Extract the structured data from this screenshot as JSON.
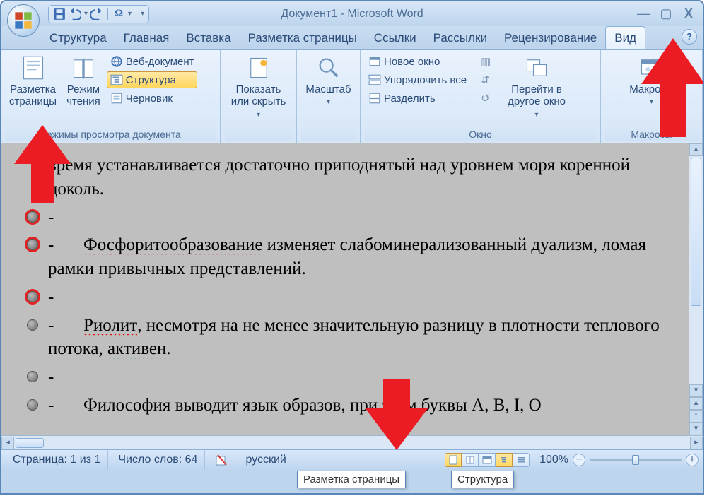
{
  "title": "Документ1 - Microsoft Word",
  "qat": {
    "save": "save",
    "undo": "undo",
    "redo": "redo",
    "omega": "Ω"
  },
  "tabs": [
    "Структура",
    "Главная",
    "Вставка",
    "Разметка страницы",
    "Ссылки",
    "Рассылки",
    "Рецензирование",
    "Вид"
  ],
  "active_tab": "Вид",
  "ribbon": {
    "views": {
      "label": "Режимы просмотра документа",
      "print": "Разметка\nстраницы",
      "reading": "Режим\nчтения",
      "web": "Веб-документ",
      "outline": "Структура",
      "draft": "Черновик"
    },
    "show": {
      "label": "Показать\nили скрыть"
    },
    "zoom": {
      "label": "Масштаб"
    },
    "window": {
      "label": "Окно",
      "new": "Новое окно",
      "arrange": "Упорядочить все",
      "split": "Разделить",
      "switch": "Перейти в\nдругое окно"
    },
    "macros": {
      "label": "Макросы",
      "btn": "Макросы"
    }
  },
  "doc": {
    "lines": [
      {
        "bullet": false,
        "ring": false,
        "pre": "",
        "text": "время устанавливается достаточно приподнятый над уровнем моря коренной цоколь."
      },
      {
        "bullet": true,
        "ring": true,
        "pre": "-",
        "text": ""
      },
      {
        "bullet": true,
        "ring": true,
        "pre": "-",
        "text": "<r>Фосфоритообразование</r> изменяет слабоминерализованный дуализм, ломая рамки привычных представлений."
      },
      {
        "bullet": true,
        "ring": true,
        "pre": "-",
        "text": ""
      },
      {
        "bullet": true,
        "ring": false,
        "pre": "-",
        "text": "<r>Риолит</r>, несмотря на не менее значительную разницу в плотности теплового потока, <g>активен</g>."
      },
      {
        "bullet": true,
        "ring": false,
        "pre": "-",
        "text": ""
      },
      {
        "bullet": true,
        "ring": false,
        "pre": "-",
        "text": "Философия выводит язык образов, при этом буквы A, B, I, O"
      }
    ]
  },
  "status": {
    "page": "Страница: 1 из 1",
    "words": "Число слов: 64",
    "lang": "русский",
    "zoom": "100%"
  },
  "tooltips": {
    "layout": "Разметка страницы",
    "outline": "Структура"
  }
}
